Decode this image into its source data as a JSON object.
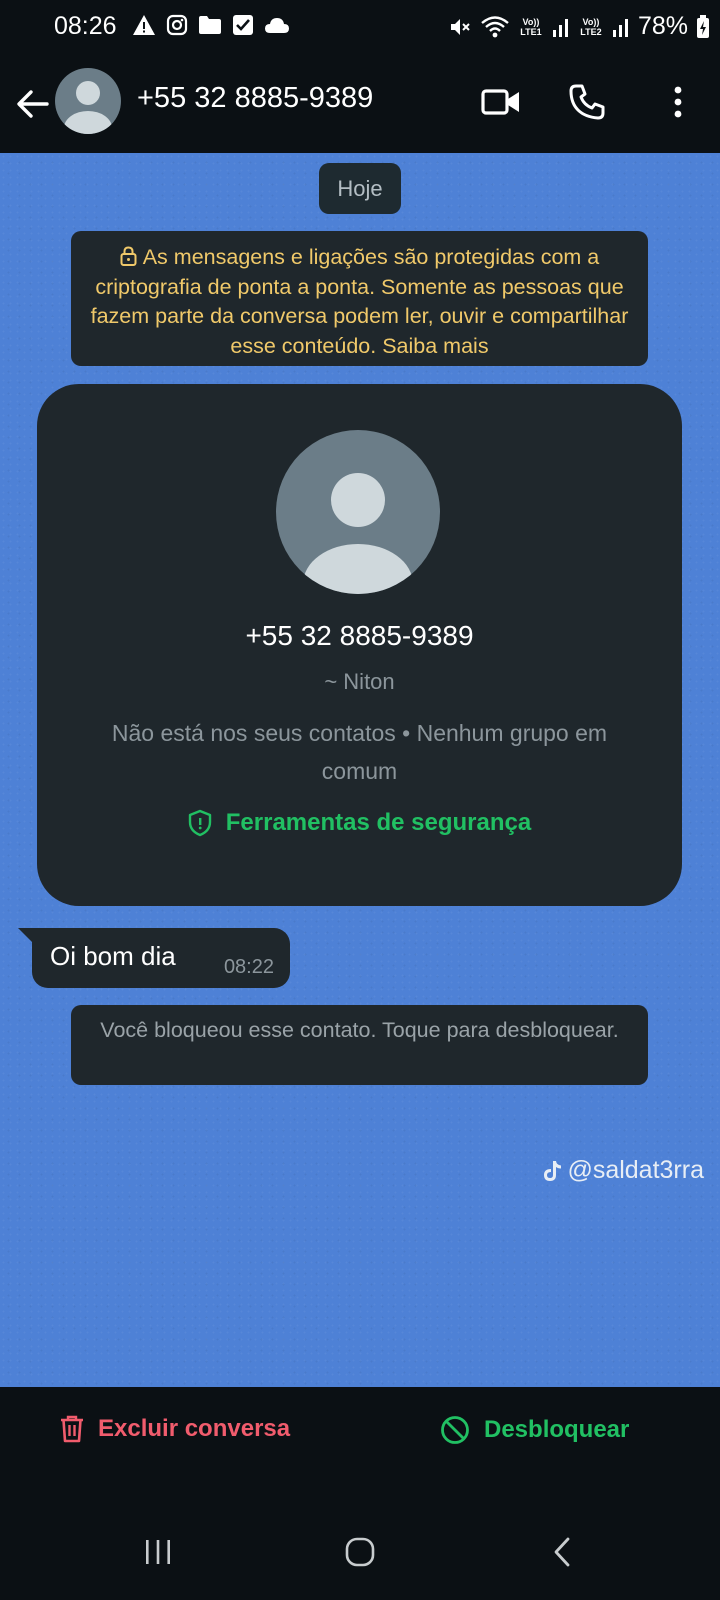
{
  "status_bar": {
    "time": "08:26",
    "battery": "78%",
    "sim1_label": "Vo)) LTE1",
    "sim2_label": "Vo)) LTE2"
  },
  "header": {
    "title": "+55 32 8885-9389"
  },
  "chat": {
    "date_chip": "Hoje",
    "encryption_notice": "As mensagens e ligações são protegidas com a criptografia de ponta a ponta. Somente as pessoas que fazem parte da conversa podem ler, ouvir e compartilhar esse conteúdo. Saiba mais",
    "contact_card": {
      "phone": "+55 32 8885-9389",
      "name": "~ Niton",
      "info": "Não está nos seus contatos • Nenhum grupo em comum",
      "security_label": "Ferramentas de segurança"
    },
    "messages": [
      {
        "text": "Oi bom dia",
        "time": "08:22"
      }
    ],
    "blocked_notice": "Você bloqueou esse contato. Toque para desbloquear.",
    "watermark": "@saldat3rra"
  },
  "actions": {
    "delete_label": "Excluir conversa",
    "unblock_label": "Desbloquear"
  },
  "icons": {
    "status_left": [
      "warning-icon",
      "instagram-icon",
      "folder-icon",
      "checkbox-icon",
      "cloud-icon"
    ],
    "status_right": [
      "mute-icon",
      "wifi-icon",
      "signal-icon",
      "battery-icon"
    ]
  },
  "colors": {
    "chat_background": "#4e81d6",
    "bubble": "#1f272c",
    "notice_text": "#f0c96a",
    "accent_green": "#21c063",
    "danger_red": "#f15c6d"
  }
}
